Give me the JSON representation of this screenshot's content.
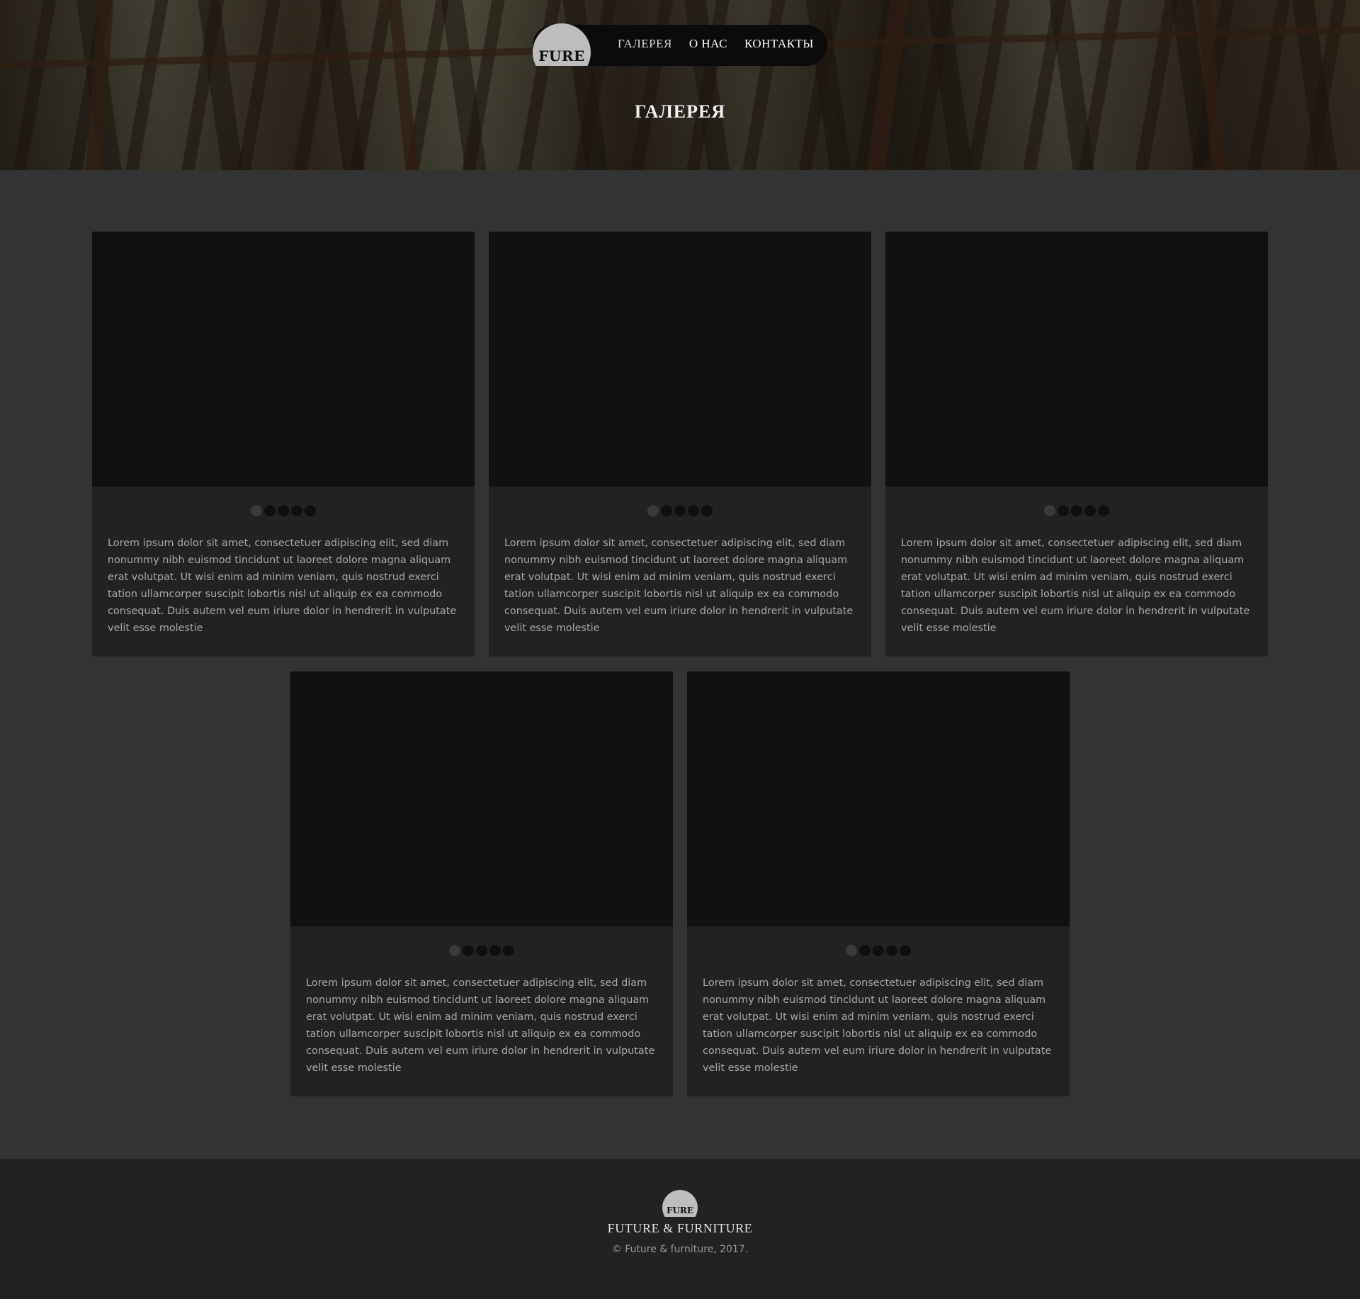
{
  "header": {
    "logo": "FURE",
    "nav": [
      {
        "label": "ГАЛЕРЕЯ",
        "active": true
      },
      {
        "label": "О НАС",
        "active": false
      },
      {
        "label": "КОНТАКТЫ",
        "active": false
      }
    ],
    "page_title": "ГАЛЕРЕЯ"
  },
  "gallery": {
    "cards": [
      {
        "text": "Lorem ipsum dolor sit amet, consectetuer adipiscing elit, sed diam nonummy nibh euismod tincidunt ut laoreet dolore magna aliquam erat volutpat. Ut wisi enim ad minim veniam, quis nostrud exerci tation ullamcorper suscipit lobortis nisl ut aliquip ex ea commodo consequat. Duis autem vel eum iriure dolor in hendrerit in vulputate velit esse molestie",
        "slides": 5,
        "active_slide": 1
      },
      {
        "text": "Lorem ipsum dolor sit amet, consectetuer adipiscing elit, sed diam nonummy nibh euismod tincidunt ut laoreet dolore magna aliquam erat volutpat. Ut wisi enim ad minim veniam, quis nostrud exerci tation ullamcorper suscipit lobortis nisl ut aliquip ex ea commodo consequat. Duis autem vel eum iriure dolor in hendrerit in vulputate velit esse molestie",
        "slides": 5,
        "active_slide": 1
      },
      {
        "text": "Lorem ipsum dolor sit amet, consectetuer adipiscing elit, sed diam nonummy nibh euismod tincidunt ut laoreet dolore magna aliquam erat volutpat. Ut wisi enim ad minim veniam, quis nostrud exerci tation ullamcorper suscipit lobortis nisl ut aliquip ex ea commodo consequat. Duis autem vel eum iriure dolor in hendrerit in vulputate velit esse molestie",
        "slides": 5,
        "active_slide": 1
      },
      {
        "text": "Lorem ipsum dolor sit amet, consectetuer adipiscing elit, sed diam nonummy nibh euismod tincidunt ut laoreet dolore magna aliquam erat volutpat. Ut wisi enim ad minim veniam, quis nostrud exerci tation ullamcorper suscipit lobortis nisl ut aliquip ex ea commodo consequat. Duis autem vel eum iriure dolor in hendrerit in vulputate velit esse molestie",
        "slides": 5,
        "active_slide": 1
      },
      {
        "text": "Lorem ipsum dolor sit amet, consectetuer adipiscing elit, sed diam nonummy nibh euismod tincidunt ut laoreet dolore magna aliquam erat volutpat. Ut wisi enim ad minim veniam, quis nostrud exerci tation ullamcorper suscipit lobortis nisl ut aliquip ex ea commodo consequat. Duis autem vel eum iriure dolor in hendrerit in vulputate velit esse molestie",
        "slides": 5,
        "active_slide": 1
      }
    ]
  },
  "footer": {
    "logo": "FURE",
    "name": "FUTURE & FURNITURE",
    "copyright": "© Future & furniture, 2017."
  },
  "colors": {
    "page_bg": "#333333",
    "card_bg": "#222222",
    "photo_placeholder": "#111111",
    "footer_bg": "#222222",
    "logo_circle": "#bdbdbd"
  }
}
